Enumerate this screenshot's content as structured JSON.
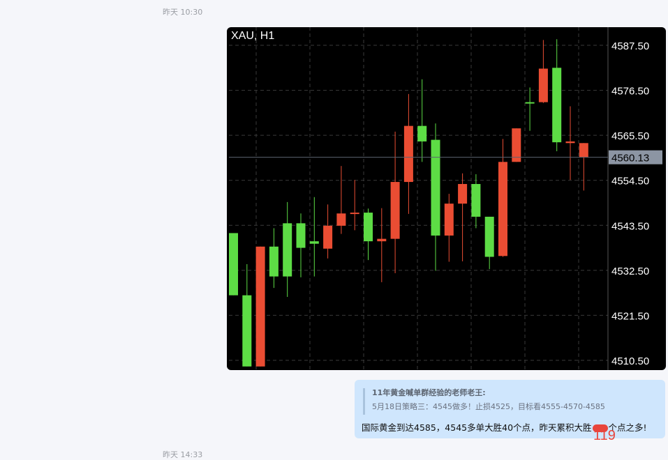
{
  "messages": {
    "timestamp_top": "昨天 10:30",
    "timestamp_bottom": "昨天 14:33",
    "quote": {
      "author": "11年黄金喊单群经验的老师老王:",
      "text": "5月18日策略三：4545做多！止损4525，目标看4555-4570-4585"
    },
    "reply": {
      "before": "国际黄金到达4585，4545多单大胜40个点，昨天累积大胜",
      "after": "个点之多!"
    },
    "red_count": "119"
  },
  "chart_data": {
    "type": "candlestick",
    "title": "XAU, H1",
    "ylim": [
      4509,
      4591
    ],
    "y_ticks": [
      4510.5,
      4521.5,
      4532.5,
      4543.5,
      4554.5,
      4565.5,
      4576.5,
      4587.5
    ],
    "y_tick_labels": [
      "4510.50",
      "4521.50",
      "4532.50",
      "4543.50",
      "4554.50",
      "4565.50",
      "4576.50",
      "4587.50"
    ],
    "current_price": 4560.13,
    "current_price_label": "4560.13",
    "grid": true,
    "colors": {
      "up": "#5ddc45",
      "down": "#ea4d33",
      "background": "#000000"
    },
    "candles": [
      {
        "o": 4526.4,
        "h": 4541.6,
        "l": 4526.4,
        "c": 4541.6
      },
      {
        "o": 4509.0,
        "h": 4534.0,
        "l": 4509.0,
        "c": 4526.4
      },
      {
        "o": 4538.3,
        "h": 4538.3,
        "l": 4509.0,
        "c": 4509.0
      },
      {
        "o": 4531.0,
        "h": 4542.8,
        "l": 4528.2,
        "c": 4538.3
      },
      {
        "o": 4531.0,
        "h": 4549.2,
        "l": 4526.0,
        "c": 4544.0
      },
      {
        "o": 4538.0,
        "h": 4546.4,
        "l": 4530.8,
        "c": 4544.0
      },
      {
        "o": 4539.0,
        "h": 4550.4,
        "l": 4531.0,
        "c": 4539.6
      },
      {
        "o": 4543.4,
        "h": 4548.6,
        "l": 4535.4,
        "c": 4537.8
      },
      {
        "o": 4546.4,
        "h": 4558.0,
        "l": 4541.4,
        "c": 4543.4
      },
      {
        "o": 4546.6,
        "h": 4554.6,
        "l": 4542.3,
        "c": 4546.4
      },
      {
        "o": 4539.6,
        "h": 4547.6,
        "l": 4535.0,
        "c": 4546.6
      },
      {
        "o": 4540.2,
        "h": 4547.7,
        "l": 4529.6,
        "c": 4539.6
      },
      {
        "o": 4554.1,
        "h": 4566.4,
        "l": 4531.8,
        "c": 4540.2
      },
      {
        "o": 4567.8,
        "h": 4575.6,
        "l": 4546.3,
        "c": 4554.1
      },
      {
        "o": 4564.0,
        "h": 4579.2,
        "l": 4559.0,
        "c": 4567.8
      },
      {
        "o": 4541.0,
        "h": 4568.4,
        "l": 4532.4,
        "c": 4564.4
      },
      {
        "o": 4548.8,
        "h": 4551.2,
        "l": 4534.6,
        "c": 4541.0
      },
      {
        "o": 4553.6,
        "h": 4556.2,
        "l": 4534.7,
        "c": 4548.8
      },
      {
        "o": 4545.6,
        "h": 4556.0,
        "l": 4542.8,
        "c": 4553.6
      },
      {
        "o": 4535.8,
        "h": 4545.6,
        "l": 4532.8,
        "c": 4545.6
      },
      {
        "o": 4559.0,
        "h": 4564.6,
        "l": 4535.8,
        "c": 4536.0
      },
      {
        "o": 4567.2,
        "h": 4566.0,
        "l": 4559.0,
        "c": 4559.0
      },
      {
        "o": 4573.6,
        "h": 4577.2,
        "l": 4566.6,
        "c": 4573.6
      },
      {
        "o": 4581.8,
        "h": 4588.8,
        "l": 4573.4,
        "c": 4573.6
      },
      {
        "o": 4563.8,
        "h": 4589.0,
        "l": 4561.6,
        "c": 4582.0
      },
      {
        "o": 4564.0,
        "h": 4572.6,
        "l": 4554.6,
        "c": 4563.6
      },
      {
        "o": 4563.6,
        "h": 4563.6,
        "l": 4552.0,
        "c": 4560.1
      }
    ]
  }
}
